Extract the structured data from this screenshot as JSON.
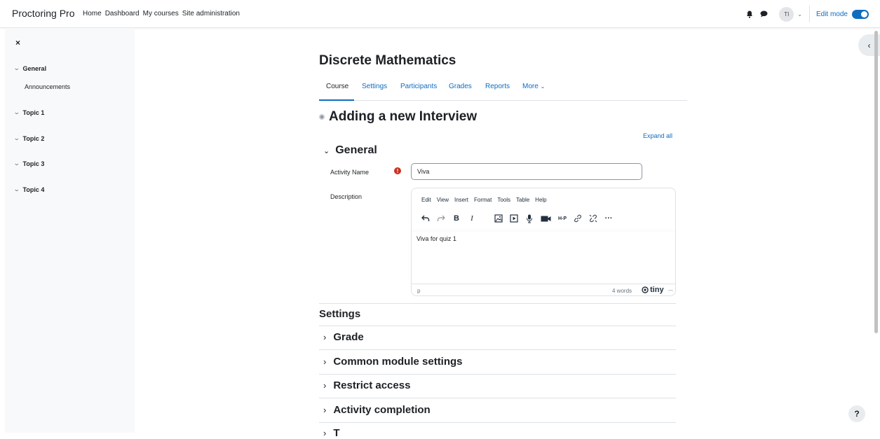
{
  "navbar": {
    "brand": "Proctoring Pro",
    "links": [
      "Home",
      "Dashboard",
      "My courses",
      "Site administration"
    ],
    "avatar_initials": "TI",
    "edit_mode_label": "Edit mode",
    "edit_mode_on": true
  },
  "drawer": {
    "close_glyph": "×",
    "sections": [
      {
        "label": "General",
        "items": [
          "Announcements"
        ]
      },
      {
        "label": "Topic 1",
        "items": []
      },
      {
        "label": "Topic 2",
        "items": []
      },
      {
        "label": "Topic 3",
        "items": []
      },
      {
        "label": "Topic 4",
        "items": []
      }
    ]
  },
  "course": {
    "title": "Discrete Mathematics",
    "tabs": [
      "Course",
      "Settings",
      "Participants",
      "Grades",
      "Reports",
      "More"
    ],
    "active_tab": "Course"
  },
  "form": {
    "heading": "Adding a new Interview",
    "expand_all": "Expand all",
    "general_header": "General",
    "activity_name_label": "Activity Name",
    "activity_name_value": "Viva",
    "description_label": "Description",
    "editor": {
      "menu": [
        "Edit",
        "View",
        "Insert",
        "Format",
        "Tools",
        "Table",
        "Help"
      ],
      "content": "Viva for quiz 1",
      "status_path": "p",
      "word_count": "4 words",
      "brand": "tiny"
    },
    "settings_header": "Settings",
    "collapsed_sections": [
      "Grade",
      "Common module settings",
      "Restrict access",
      "Activity completion",
      "T"
    ]
  },
  "colors": {
    "accent": "#0f6cbf",
    "required": "#ca3120",
    "drawer_bg": "#f8f9fa"
  }
}
